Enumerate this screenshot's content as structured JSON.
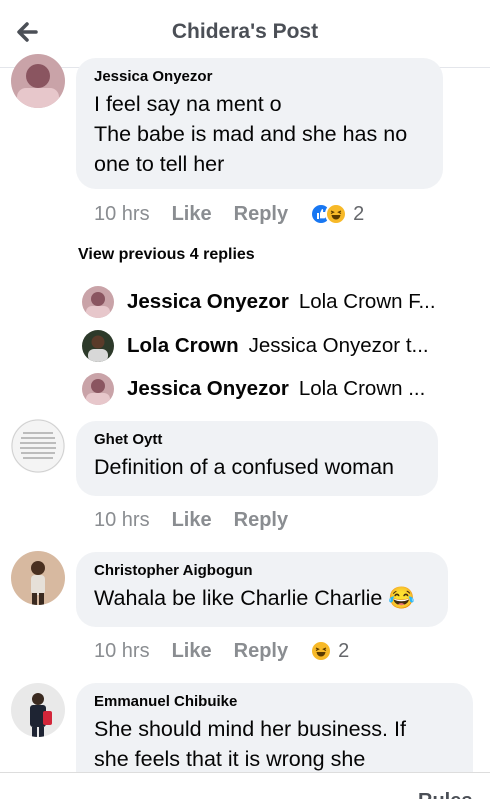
{
  "header": {
    "title": "Chidera's Post"
  },
  "comments": [
    {
      "name": "Jessica Onyezor",
      "lines": [
        "I feel say na ment o",
        "The babe is mad and she has no",
        "one to tell her"
      ],
      "time": "10 hrs",
      "like": "Like",
      "reply": "Reply",
      "reaction_count": "2",
      "reactions": [
        "like-icon",
        "haha-icon"
      ]
    },
    {
      "name": "Ghet Oytt",
      "lines": [
        "Definition of a confused woman"
      ],
      "time": "10 hrs",
      "like": "Like",
      "reply": "Reply"
    },
    {
      "name": "Christopher Aigbogun",
      "lines": [
        "Wahala be like Charlie Charlie 😂"
      ],
      "time": "10 hrs",
      "like": "Like",
      "reply": "Reply",
      "reaction_count": "2",
      "reactions": [
        "haha-icon"
      ]
    },
    {
      "name": "Emmanuel Chibuike",
      "lines": [
        "She should mind her business. If",
        "she feels that it is wrong she"
      ]
    }
  ],
  "view_previous": "View previous 4 replies",
  "replies": [
    {
      "name": "Jessica Onyezor",
      "text": "Lola Crown F..."
    },
    {
      "name": "Lola Crown",
      "text": "Jessica Onyezor t..."
    },
    {
      "name": "Jessica Onyezor",
      "text": "Lola Crown ..."
    }
  ],
  "footer": {
    "rules": "Rules"
  },
  "colors": {
    "bubble": "#f0f2f5",
    "meta": "#8a8d91",
    "like_blue": "#1877f2",
    "haha_yellow": "#f7b928"
  },
  "icons": {
    "back": "back-arrow-icon"
  }
}
